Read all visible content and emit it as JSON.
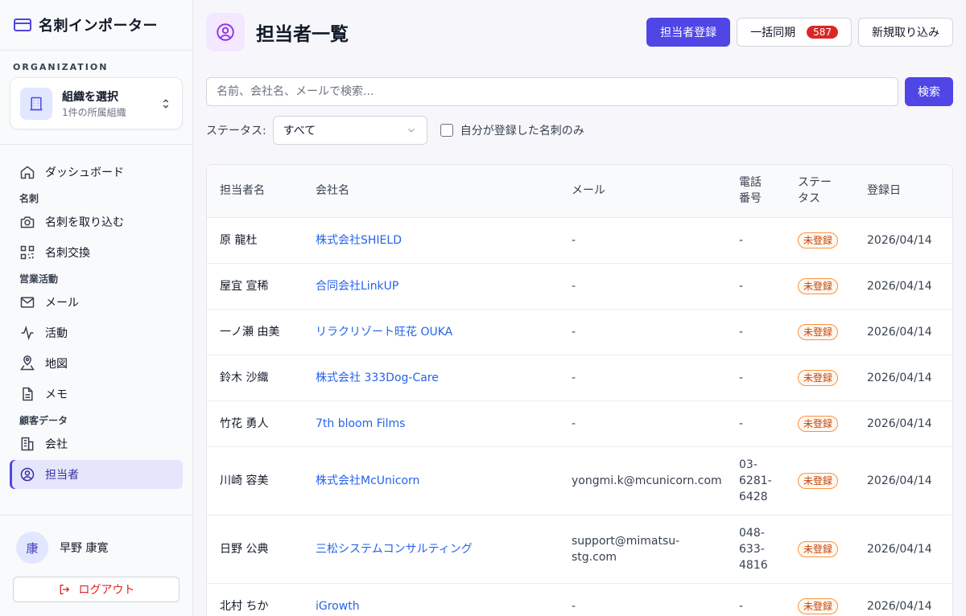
{
  "app": {
    "title": "名刺インポーター"
  },
  "org": {
    "section_label": "ORGANIZATION",
    "name": "組織を選択",
    "sub": "1件の所属組織"
  },
  "nav": {
    "dashboard": "ダッシュボード",
    "group_meishi": "名刺",
    "import": "名刺を取り込む",
    "exchange": "名刺交換",
    "group_sales": "営業活動",
    "mail": "メール",
    "activity": "活動",
    "map": "地図",
    "memo": "メモ",
    "group_customer": "顧客データ",
    "company": "会社",
    "contacts": "担当者"
  },
  "user": {
    "avatar": "康",
    "name": "早野 康寛",
    "logout": "ログアウト"
  },
  "page": {
    "title": "担当者一覧"
  },
  "actions": {
    "register": "担当者登録",
    "sync": "一括同期",
    "sync_count": "587",
    "import_new": "新規取り込み"
  },
  "search": {
    "placeholder": "名前、会社名、メールで検索...",
    "button": "検索"
  },
  "filter": {
    "status_label": "ステータス:",
    "status_value": "すべて",
    "mine_only": "自分が登録した名刺のみ"
  },
  "table": {
    "headers": {
      "name": "担当者名",
      "company": "会社名",
      "email": "メール",
      "phone_1": "電話",
      "phone_2": "番号",
      "status_1": "ステー",
      "status_2": "タス",
      "date": "登録日"
    },
    "rows": [
      {
        "name": "原 龍杜",
        "company": "株式会社SHIELD",
        "email": "-",
        "phone": [
          "-"
        ],
        "status": "未登録",
        "date": "2026/04/14"
      },
      {
        "name": "屋宜 宣稀",
        "company": "合同会社LinkUP",
        "email": "-",
        "phone": [
          "-"
        ],
        "status": "未登録",
        "date": "2026/04/14"
      },
      {
        "name": "一ノ瀬 由美",
        "company": "リラクリゾート旺花 OUKA",
        "email": "-",
        "phone": [
          "-"
        ],
        "status": "未登録",
        "date": "2026/04/14"
      },
      {
        "name": "鈴木 沙織",
        "company": "株式会社 333Dog-Care",
        "email": "-",
        "phone": [
          "-"
        ],
        "status": "未登録",
        "date": "2026/04/14"
      },
      {
        "name": "竹花 勇人",
        "company": "7th bloom Films",
        "email": "-",
        "phone": [
          "-"
        ],
        "status": "未登録",
        "date": "2026/04/14"
      },
      {
        "name": "川崎 容美",
        "company": "株式会社McUnicorn",
        "email": "yongmi.k@mcunicorn.com",
        "phone": [
          "03-",
          "6281-",
          "6428"
        ],
        "status": "未登録",
        "date": "2026/04/14"
      },
      {
        "name": "日野 公典",
        "company": "三松システムコンサルティング",
        "email": "support@mimatsu-stg.com",
        "phone": [
          "048-",
          "633-",
          "4816"
        ],
        "status": "未登録",
        "date": "2026/04/14"
      },
      {
        "name": "北村 ちか",
        "company": "iGrowth",
        "email": "-",
        "phone": [
          "-"
        ],
        "status": "未登録",
        "date": "2026/04/14"
      }
    ]
  }
}
